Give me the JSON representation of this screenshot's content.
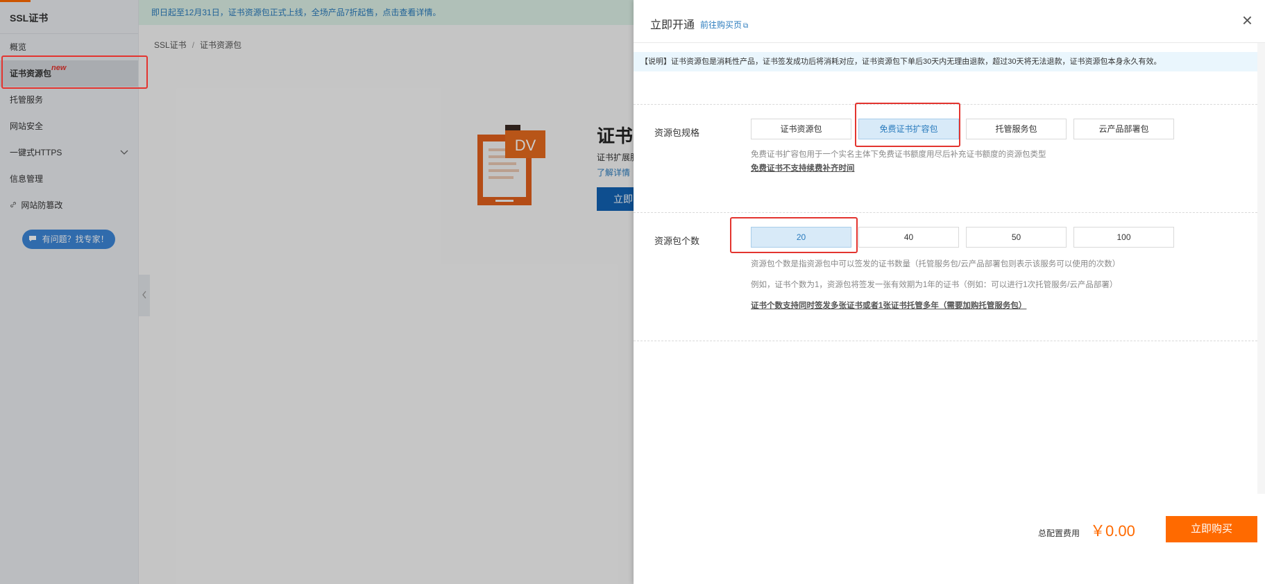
{
  "sidebar": {
    "brand": "SSL证书",
    "items": [
      {
        "label": "概览"
      },
      {
        "label": "证书资源包",
        "badge": "new"
      },
      {
        "label": "托管服务"
      },
      {
        "label": "网站安全"
      },
      {
        "label": "一键式HTTPS"
      },
      {
        "label": "信息管理"
      },
      {
        "label": "网站防篡改"
      }
    ],
    "help_button": "有问题？找专家！"
  },
  "main": {
    "banner": "即日起至12月31日，证书资源包正式上线，全场产品7折起售，点击查看详情。",
    "breadcrumb": [
      "SSL证书",
      "证书资源包"
    ],
    "product": {
      "icon_badge": "DV",
      "title": "证书",
      "desc": "证书扩展服",
      "link": "了解详情",
      "button": "立即"
    }
  },
  "drawer": {
    "title": "立即开通",
    "buy_page_link": "前往购买页",
    "notice": "【说明】证书资源包是消耗性产品，证书签发成功后将消耗对应，证书资源包下单后30天内无理由退款，超过30天将无法退款，证书资源包本身永久有效。",
    "spec": {
      "label": "资源包规格",
      "options": [
        "证书资源包",
        "免费证书扩容包",
        "托管服务包",
        "云产品部署包"
      ],
      "selected": "免费证书扩容包",
      "hint": "免费证书扩容包用于一个实名主体下免费证书额度用尽后补充证书额度的资源包类型",
      "hint_strong": "免费证书不支持续费补齐时间"
    },
    "count": {
      "label": "资源包个数",
      "options": [
        "20",
        "40",
        "50",
        "100"
      ],
      "selected": "20",
      "hint1": "资源包个数是指资源包中可以签发的证书数量（托管服务包/云产品部署包则表示该服务可以使用的次数）",
      "hint2": "例如，证书个数为1，资源包将签发一张有效期为1年的证书（例如：可以进行1次托管服务/云产品部署）",
      "hint_strong": "证书个数支持同时签发多张证书或者1张证书托管多年（需要加购托管服务包）"
    },
    "footer": {
      "total_label": "总配置费用",
      "total_price": "￥0.00",
      "buy_button": "立即购买"
    }
  },
  "colors": {
    "accent": "#ff6a00",
    "primary": "#2a7bbd",
    "highlight": "#e3342f"
  }
}
